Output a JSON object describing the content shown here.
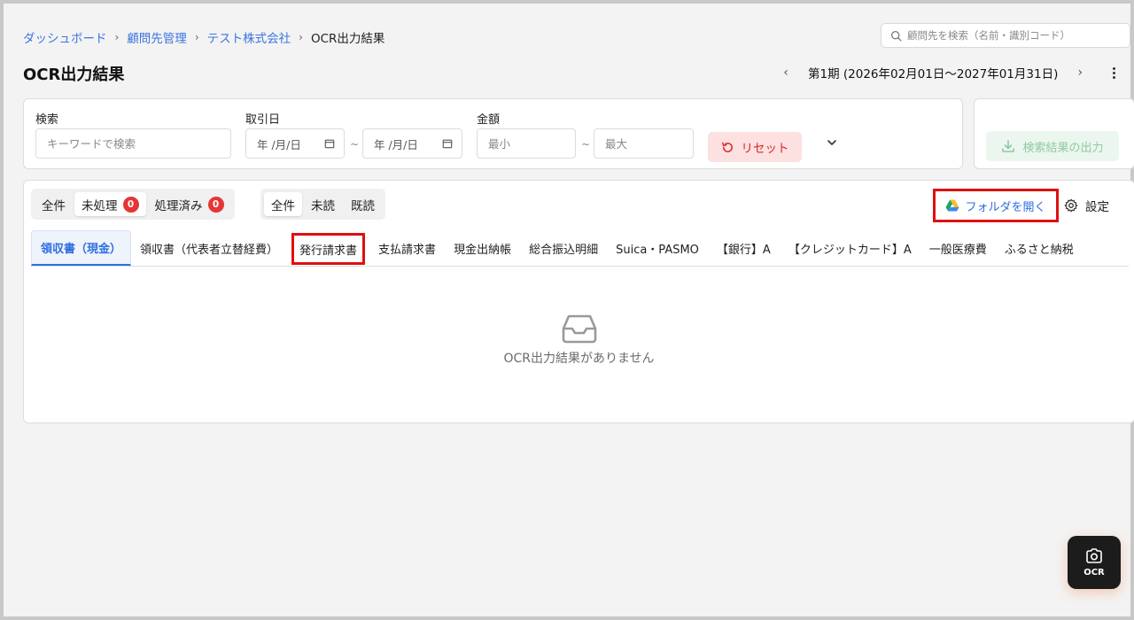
{
  "breadcrumb": {
    "items": [
      "ダッシュボード",
      "顧問先管理",
      "テスト株式会社"
    ],
    "current": "OCR出力結果"
  },
  "search": {
    "placeholder": "顧問先を検索（名前・識別コード）"
  },
  "page": {
    "title": "OCR出力結果"
  },
  "period": {
    "label": "第1期 (2026年02月01日〜2027年01月31日)"
  },
  "filters": {
    "keyword_label": "検索",
    "keyword_placeholder": "キーワードで検索",
    "date_label": "取引日",
    "date_from": "年 /月/日",
    "date_to": "年 /月/日",
    "amount_label": "金額",
    "amount_min_placeholder": "最小",
    "amount_max_placeholder": "最大",
    "tilde": "~",
    "reset_label": "リセット"
  },
  "export": {
    "label": "検索結果の出力"
  },
  "status_filter": {
    "items": [
      {
        "label": "全件",
        "badge": null
      },
      {
        "label": "未処理",
        "badge": "0"
      },
      {
        "label": "処理済み",
        "badge": "0"
      }
    ],
    "active": 1
  },
  "read_filter": {
    "items": [
      "全件",
      "未読",
      "既読"
    ],
    "active": 0
  },
  "actions": {
    "folder_label": "フォルダを開く",
    "settings_label": "設定"
  },
  "tabs": {
    "items": [
      "領収書（現金）",
      "領収書（代表者立替経費）",
      "発行請求書",
      "支払請求書",
      "現金出納帳",
      "総合振込明細",
      "Suica・PASMO",
      "【銀行】A",
      "【クレジットカード】A",
      "一般医療費",
      "ふるさと納税"
    ],
    "active": 0,
    "highlighted": 2
  },
  "empty_state": {
    "message": "OCR出力結果がありません"
  },
  "fab": {
    "label": "OCR"
  },
  "colors": {
    "accent": "#2d6fe0",
    "danger": "#e53535",
    "highlight": "#e01010",
    "export_text": "#8fc9a2"
  }
}
